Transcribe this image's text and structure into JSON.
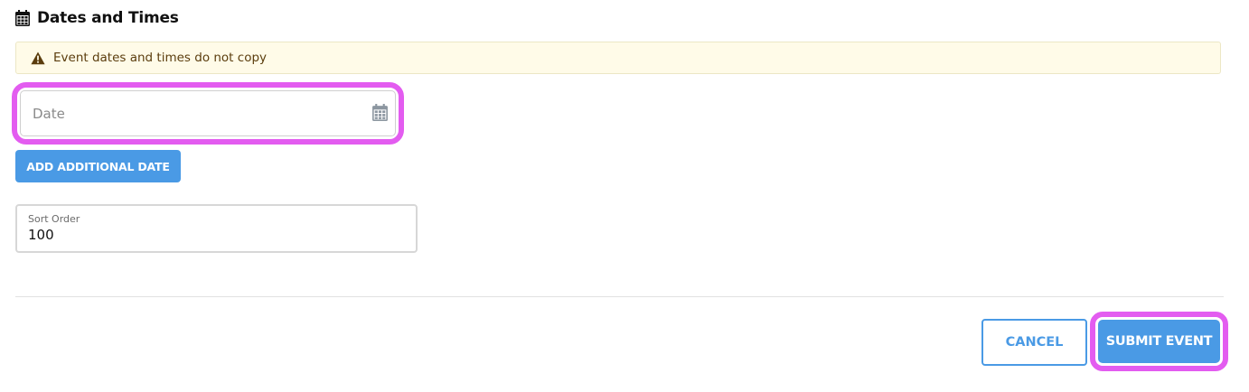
{
  "section": {
    "title": "Dates and Times",
    "icon": "calendar-icon"
  },
  "alert": {
    "icon": "warning-icon",
    "text": "Event dates and times do not copy",
    "colors": {
      "background": "#fffbe8",
      "text": "#5b3d0d"
    }
  },
  "date_field": {
    "placeholder": "Date",
    "value": "",
    "icon": "calendar-icon"
  },
  "add_date_button": {
    "label": "ADD ADDITIONAL DATE"
  },
  "sort_order": {
    "label": "Sort Order",
    "value": "100"
  },
  "actions": {
    "cancel_label": "CANCEL",
    "submit_label": "SUBMIT EVENT"
  },
  "colors": {
    "accent": "#4a9ae5",
    "highlight": "#e35cf0"
  }
}
